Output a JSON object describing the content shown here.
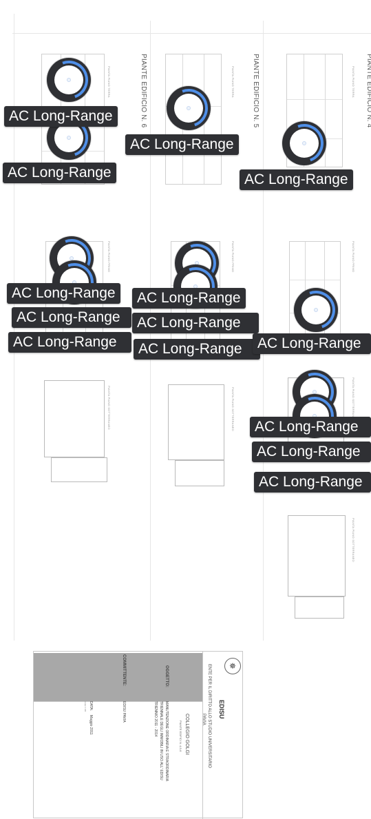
{
  "drawing": {
    "plant_titles": [
      "PIANTE EDIFICIO N. 6",
      "PIANTE EDIFICIO N. 5",
      "PIANTE EDIFICIO N. 4"
    ],
    "floor_labels": {
      "ground": "PIANTA PIANO TERRA",
      "first": "PIANTA PIANO PRIMO",
      "basement": "PIANTA PIANO SOTTERRANEO"
    }
  },
  "access_points": {
    "label": "AC Long-Range",
    "ring_color": "#4f8fe8",
    "badge_color": "#2f3034",
    "icon": "unifi-ap-icon"
  },
  "title_block": {
    "org_short": "EDISU",
    "org_full_1": "ENTE PER IL DIRITTO ALLO STUDIO UNIVERSITARIO",
    "org_full_2": "PAVIA",
    "project": "COLLEGIO GOLGI",
    "project_sub": "PIANTE EDIFICI N. 4-5-6",
    "oggetto_label": "OGGETTO:",
    "oggetto_1": "MANUTENZIONE ORDINARIA E STRAORDINARIA",
    "oggetto_2": "TRIENNALE DEGLI IMMOBILI IN USO ALL' EDISU",
    "oggetto_3": "TRIENNIO 2011 - 2014",
    "committente_label": "COMMITTENTE:",
    "committente_value": "EDISU PAVIA",
    "data_label": "DATA:",
    "data_value": "Maggio 2011",
    "scala": "scala 1:100",
    "logo_icon": "seal-logo-icon"
  }
}
